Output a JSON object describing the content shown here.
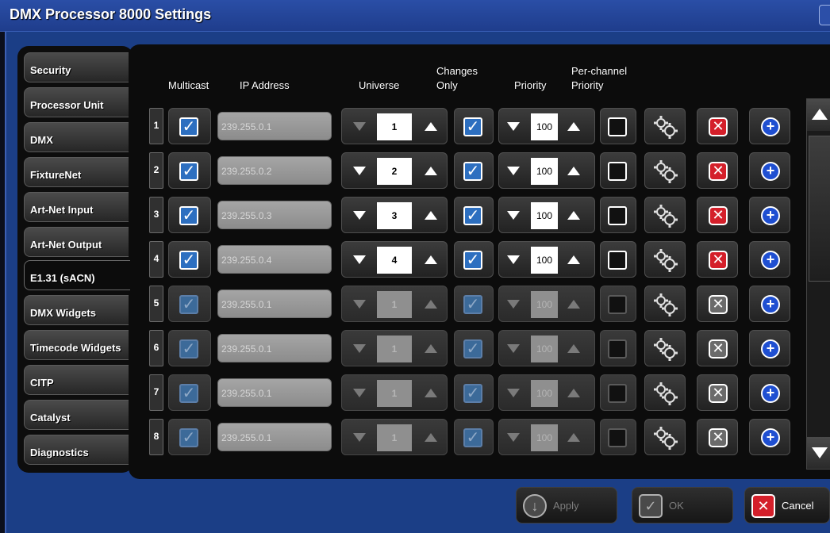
{
  "window": {
    "title": "DMX Processor 8000 Settings"
  },
  "sidebar": {
    "items": [
      {
        "label": "Security"
      },
      {
        "label": "Processor Unit"
      },
      {
        "label": "DMX"
      },
      {
        "label": "FixtureNet"
      },
      {
        "label": "Art-Net Input"
      },
      {
        "label": "Art-Net Output"
      },
      {
        "label": "E1.31 (sACN)"
      },
      {
        "label": "DMX Widgets"
      },
      {
        "label": "Timecode Widgets"
      },
      {
        "label": "CITP"
      },
      {
        "label": "Catalyst"
      },
      {
        "label": "Diagnostics"
      }
    ],
    "active": "E1.31 (sACN)"
  },
  "table": {
    "headers": {
      "multicast": "Multicast",
      "ip_address": "IP Address",
      "universe": "Universe",
      "changes_only_1": "Changes",
      "changes_only_2": "Only",
      "priority": "Priority",
      "per_channel_1": "Per-channel",
      "per_channel_2": "Priority"
    },
    "rows": [
      {
        "num": "1",
        "multicast": true,
        "ip": "239.255.0.1",
        "universe": "1",
        "changes_only": true,
        "priority": "100",
        "per_channel": false,
        "enabled": true
      },
      {
        "num": "2",
        "multicast": true,
        "ip": "239.255.0.2",
        "universe": "2",
        "changes_only": true,
        "priority": "100",
        "per_channel": false,
        "enabled": true
      },
      {
        "num": "3",
        "multicast": true,
        "ip": "239.255.0.3",
        "universe": "3",
        "changes_only": true,
        "priority": "100",
        "per_channel": false,
        "enabled": true
      },
      {
        "num": "4",
        "multicast": true,
        "ip": "239.255.0.4",
        "universe": "4",
        "changes_only": true,
        "priority": "100",
        "per_channel": false,
        "enabled": true
      },
      {
        "num": "5",
        "multicast": true,
        "ip": "239.255.0.1",
        "universe": "1",
        "changes_only": true,
        "priority": "100",
        "per_channel": false,
        "enabled": false
      },
      {
        "num": "6",
        "multicast": true,
        "ip": "239.255.0.1",
        "universe": "1",
        "changes_only": true,
        "priority": "100",
        "per_channel": false,
        "enabled": false
      },
      {
        "num": "7",
        "multicast": true,
        "ip": "239.255.0.1",
        "universe": "1",
        "changes_only": true,
        "priority": "100",
        "per_channel": false,
        "enabled": false
      },
      {
        "num": "8",
        "multicast": true,
        "ip": "239.255.0.1",
        "universe": "1",
        "changes_only": true,
        "priority": "100",
        "per_channel": false,
        "enabled": false
      }
    ]
  },
  "footer": {
    "apply_label": "Apply",
    "ok_label": "OK",
    "cancel_label": "Cancel"
  },
  "colors": {
    "title_bar": "#2a4ea6",
    "window_bg": "#1b3e86",
    "check_blue": "#2d6fc0",
    "delete_red": "#d41f2a",
    "add_blue": "#1f4fd1"
  }
}
